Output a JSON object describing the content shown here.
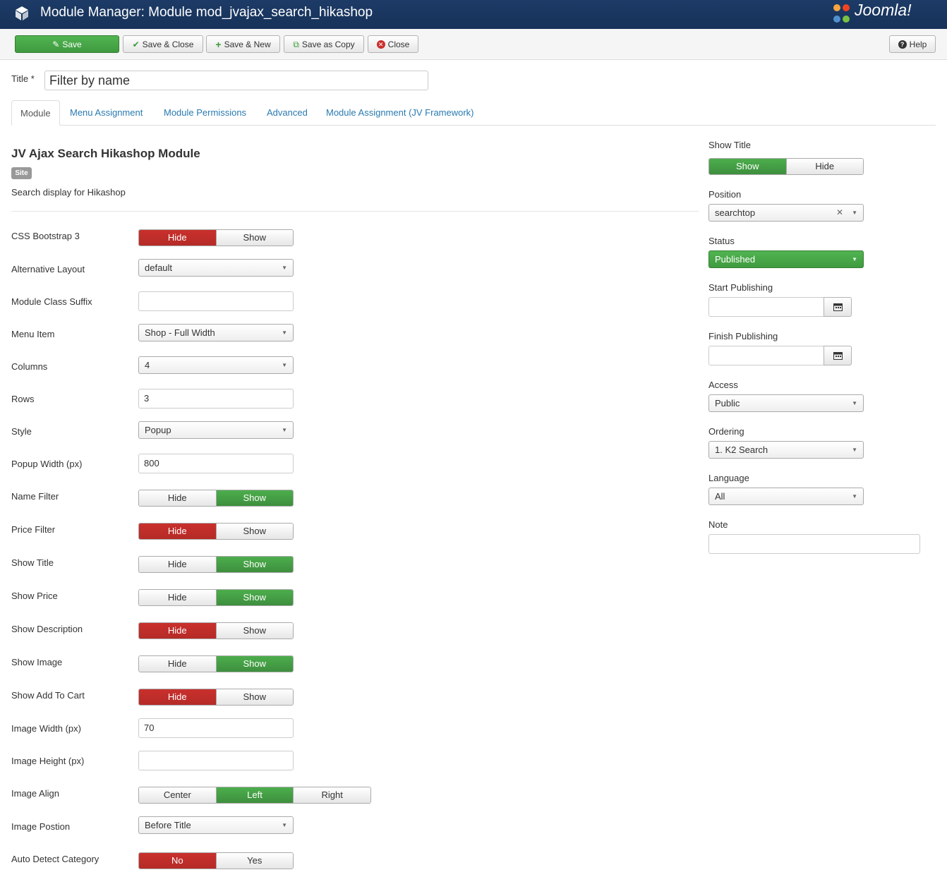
{
  "header": {
    "title": "Module Manager: Module mod_jvajax_search_hikashop",
    "brand": "Joomla!"
  },
  "toolbar": {
    "save": "Save",
    "save_close": "Save & Close",
    "save_new": "Save & New",
    "save_copy": "Save as Copy",
    "close": "Close",
    "help": "Help"
  },
  "title_field": {
    "label": "Title *",
    "value": "Filter by name"
  },
  "tabs": [
    "Module",
    "Menu Assignment",
    "Module Permissions",
    "Advanced",
    "Module Assignment (JV Framework)"
  ],
  "module": {
    "name": "JV Ajax Search Hikashop Module",
    "badge": "Site",
    "description": "Search display for Hikashop"
  },
  "fields": {
    "css_bootstrap": {
      "label": "CSS Bootstrap 3",
      "opt1": "Hide",
      "opt2": "Show",
      "selected": "Hide"
    },
    "alt_layout": {
      "label": "Alternative Layout",
      "value": "default"
    },
    "class_suffix": {
      "label": "Module Class Suffix",
      "value": ""
    },
    "menu_item": {
      "label": "Menu Item",
      "value": "Shop - Full Width"
    },
    "columns": {
      "label": "Columns",
      "value": "4"
    },
    "rows": {
      "label": "Rows",
      "value": "3"
    },
    "style": {
      "label": "Style",
      "value": "Popup"
    },
    "popup_width": {
      "label": "Popup Width (px)",
      "value": "800"
    },
    "name_filter": {
      "label": "Name Filter",
      "opt1": "Hide",
      "opt2": "Show",
      "selected": "Show"
    },
    "price_filter": {
      "label": "Price Filter",
      "opt1": "Hide",
      "opt2": "Show",
      "selected": "Hide"
    },
    "show_title": {
      "label": "Show Title",
      "opt1": "Hide",
      "opt2": "Show",
      "selected": "Show"
    },
    "show_price": {
      "label": "Show Price",
      "opt1": "Hide",
      "opt2": "Show",
      "selected": "Show"
    },
    "show_description": {
      "label": "Show Description",
      "opt1": "Hide",
      "opt2": "Show",
      "selected": "Hide"
    },
    "show_image": {
      "label": "Show Image",
      "opt1": "Hide",
      "opt2": "Show",
      "selected": "Show"
    },
    "show_add_to_cart": {
      "label": "Show Add To Cart",
      "opt1": "Hide",
      "opt2": "Show",
      "selected": "Hide"
    },
    "image_width": {
      "label": "Image Width (px)",
      "value": "70"
    },
    "image_height": {
      "label": "Image Height (px)",
      "value": ""
    },
    "image_align": {
      "label": "Image Align",
      "opt1": "Center",
      "opt2": "Left",
      "opt3": "Right",
      "selected": "Left"
    },
    "image_position": {
      "label": "Image Postion",
      "value": "Before Title"
    },
    "auto_detect": {
      "label": "Auto Detect Category",
      "opt1": "No",
      "opt2": "Yes",
      "selected": "No"
    }
  },
  "sidebar": {
    "show_title": {
      "label": "Show Title",
      "opt1": "Show",
      "opt2": "Hide",
      "selected": "Show"
    },
    "position": {
      "label": "Position",
      "value": "searchtop"
    },
    "status": {
      "label": "Status",
      "value": "Published"
    },
    "start_publishing": {
      "label": "Start Publishing",
      "value": ""
    },
    "finish_publishing": {
      "label": "Finish Publishing",
      "value": ""
    },
    "access": {
      "label": "Access",
      "value": "Public"
    },
    "ordering": {
      "label": "Ordering",
      "value": "1. K2 Search"
    },
    "language": {
      "label": "Language",
      "value": "All"
    },
    "note": {
      "label": "Note",
      "value": ""
    }
  },
  "colors": {
    "header_bg": "#17325a",
    "primary_green": "#46a546",
    "danger_red": "#bd362f",
    "link_blue": "#2a7ab0"
  }
}
